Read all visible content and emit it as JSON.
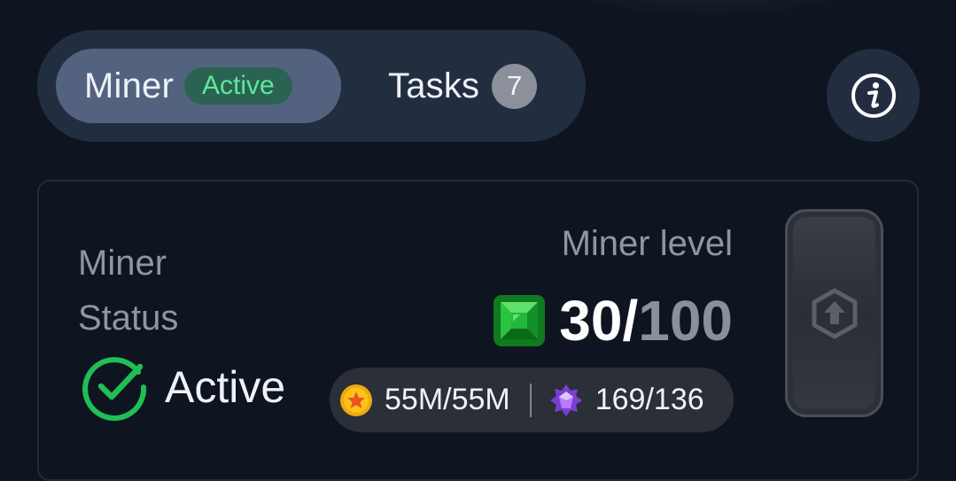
{
  "tabs": [
    {
      "label": "Miner",
      "badge": "Active",
      "selected": true
    },
    {
      "label": "Tasks",
      "count": "7",
      "selected": false
    }
  ],
  "info_button": {
    "icon": "info-icon"
  },
  "miner_status": {
    "title_line1": "Miner",
    "title_line2": "Status",
    "status_text": "Active",
    "status_icon": "check-circle-icon",
    "status_color": "#1fbf55"
  },
  "miner_level": {
    "label": "Miner level",
    "current": "30",
    "separator": "/",
    "max": "100",
    "icon": "emerald-gem-icon"
  },
  "resources": {
    "coins": {
      "value": "55M/55M",
      "icon": "gold-coin-icon"
    },
    "crystals": {
      "value": "169/136",
      "icon": "purple-crystal-icon"
    }
  },
  "upgrade_button": {
    "icon": "upgrade-arrow-icon",
    "enabled": false
  },
  "colors": {
    "background": "#0f1520",
    "tab_bar": "#222e40",
    "tab_selected": "#53637f",
    "active_badge_bg": "#2b6352",
    "active_badge_text": "#5ee89a",
    "muted_text": "#8e96a3"
  }
}
